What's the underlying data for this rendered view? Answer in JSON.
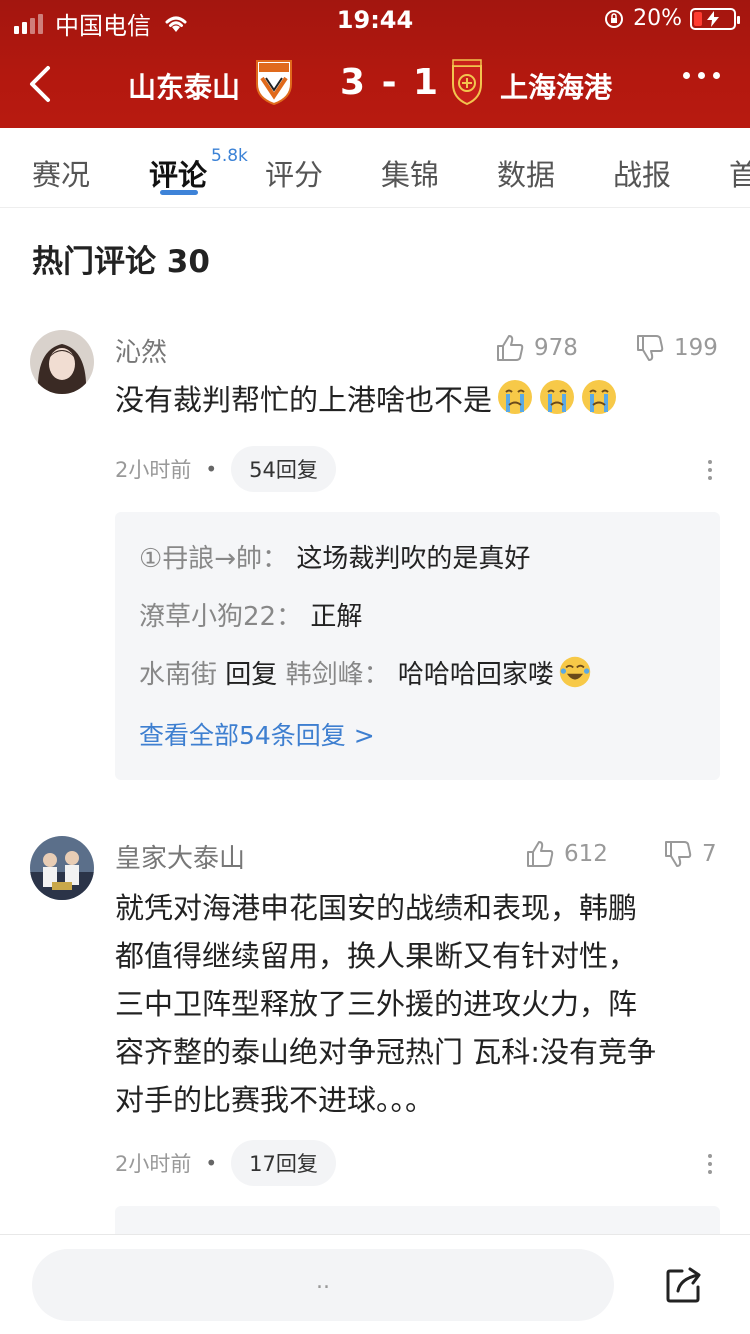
{
  "status_bar": {
    "carrier": "中国电信",
    "time": "19:44",
    "battery": "20%",
    "battery_level": 0.2
  },
  "header": {
    "home_team": "山东泰山",
    "score": "3 - 1",
    "away_team": "上海海港"
  },
  "tabs": [
    {
      "label": "赛况"
    },
    {
      "label": "评论",
      "badge": "5.8k"
    },
    {
      "label": "评分"
    },
    {
      "label": "集锦"
    },
    {
      "label": "数据"
    },
    {
      "label": "战报"
    },
    {
      "label": "首"
    }
  ],
  "section": {
    "title": "热门评论 30"
  },
  "comments": [
    {
      "user": "沁然",
      "likes": "978",
      "dislikes": "199",
      "text": "没有裁判帮忙的上港啥也不是",
      "time": "2小时前",
      "replies_label": "54回复",
      "replies": [
        {
          "user": "①冄誏→帥：",
          "text": "这场裁判吹的是真好"
        },
        {
          "user": "潦草小狗22：",
          "text": "正解"
        },
        {
          "user": "水南街",
          "reply_word": "回复",
          "target": "韩剑峰：",
          "text": "哈哈哈回家喽"
        }
      ],
      "view_all": "查看全部54条回复 >"
    },
    {
      "user": "皇家大泰山",
      "likes": "612",
      "dislikes": "7",
      "text_lines": [
        "就凭对海港申花国安的战绩和表现，韩鹏",
        "都值得继续留用，换人果断又有针对性，",
        "三中卫阵型释放了三外援的进攻火力，阵",
        "容齐整的泰山绝对争冠热门 瓦科:没有竞争",
        "对手的比赛我不进球。。。"
      ],
      "time": "2小时前",
      "replies_label": "17回复"
    }
  ],
  "bottom_bar": {
    "placeholder": ".."
  },
  "colors": {
    "header_red": "#b3180f",
    "accent_blue": "#3e83d8"
  }
}
